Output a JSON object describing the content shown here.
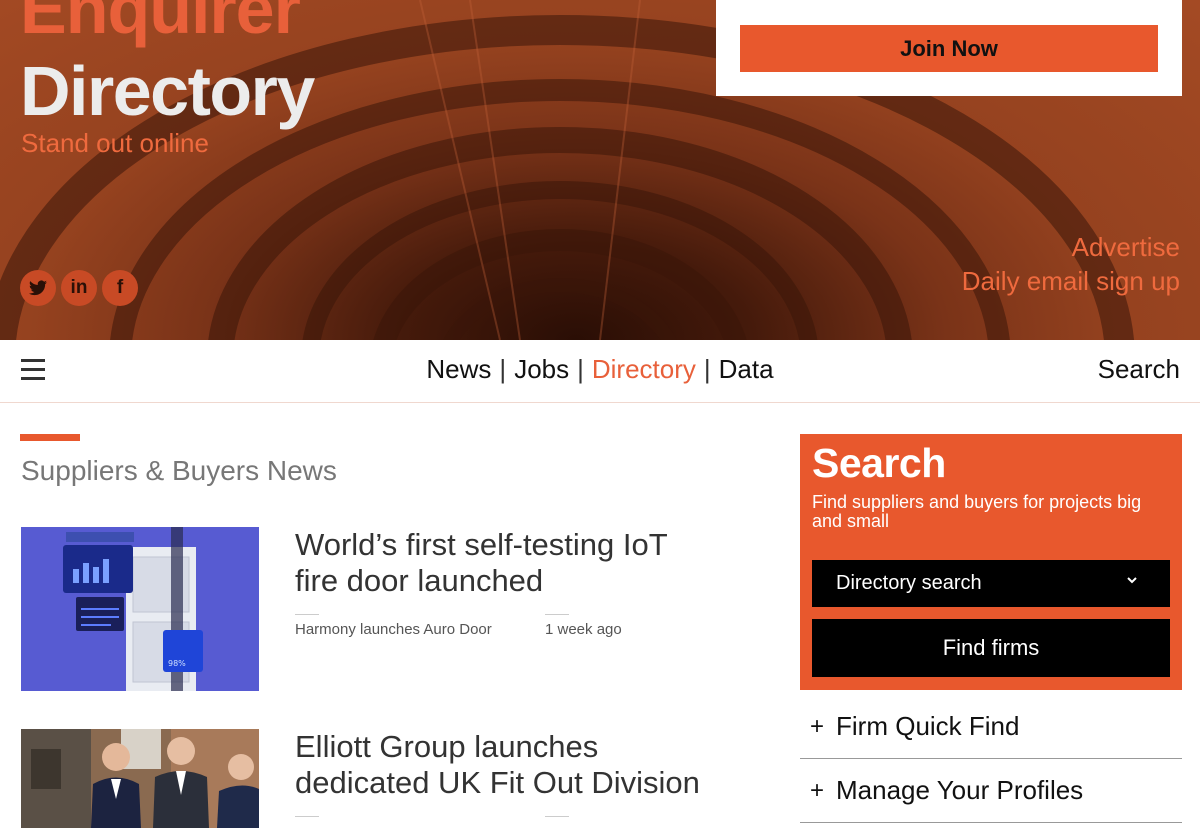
{
  "hero": {
    "logo_top": "Enquirer",
    "logo_main": "Directory",
    "tagline": "Stand out online",
    "links": [
      "Advertise",
      "Daily email sign up"
    ],
    "social": [
      {
        "icon": "twitter-icon",
        "glyph": "🐦"
      },
      {
        "icon": "linkedin-icon",
        "glyph": "in"
      },
      {
        "icon": "facebook-icon",
        "glyph": "f"
      }
    ],
    "join_label": "Join Now"
  },
  "nav": {
    "items": [
      "News",
      "Jobs",
      "Directory",
      "Data"
    ],
    "active": "Directory",
    "search_label": "Search"
  },
  "main": {
    "section_title": "Suppliers & Buyers News",
    "articles": [
      {
        "title": "World’s first self-testing IoT fire door launched",
        "subtitle": "Harmony launches Auro Door",
        "time": "1 week ago"
      },
      {
        "title": "Elliott Group launches dedicated UK Fit Out Division",
        "subtitle": "",
        "time": ""
      }
    ]
  },
  "sidebar": {
    "search_title": "Search",
    "search_desc": "Find suppliers and buyers for projects big and small",
    "select_value": "Directory search",
    "find_button": "Find firms",
    "accordion": [
      "Firm Quick Find",
      "Manage Your Profiles"
    ]
  },
  "colors": {
    "accent": "#e8582d",
    "hero_bg": "#8b3c1d"
  }
}
